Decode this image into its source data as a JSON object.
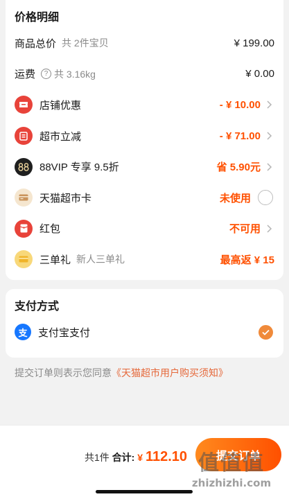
{
  "price_section": {
    "title": "价格明细",
    "rows": [
      {
        "label": "商品总价",
        "sub": "共 2件宝贝",
        "value": "¥ 199.00"
      },
      {
        "label": "运费",
        "sub": "共 3.16kg",
        "value": "¥ 0.00"
      },
      {
        "label": "店铺优惠",
        "value": "- ¥ 10.00"
      },
      {
        "label": "超市立减",
        "value": "- ¥ 71.00"
      },
      {
        "label": "88VIP 专享 9.5折",
        "value": "省 5.90元"
      },
      {
        "label": "天猫超市卡",
        "value": "未使用"
      },
      {
        "label": "红包",
        "value": "不可用"
      },
      {
        "label": "三单礼",
        "sub": "新人三单礼",
        "value": "最高返 ¥ 15"
      }
    ]
  },
  "payment_section": {
    "title": "支付方式",
    "method": "支付宝支付",
    "alipay_glyph": "支"
  },
  "agreement": {
    "prefix": "提交订单则表示您同意",
    "link": "《天猫超市用户购买须知》"
  },
  "bottom_bar": {
    "count": "共1件",
    "total_label": "合计:",
    "currency": "¥",
    "amount": "112.10",
    "submit_label": "提交订单"
  },
  "watermark": {
    "big": "值值值",
    "small": "zhizhizhi.com"
  },
  "colors": {
    "accent": "#ff5000",
    "icon_red": "#e8433a",
    "alipay_blue": "#1677ff"
  }
}
